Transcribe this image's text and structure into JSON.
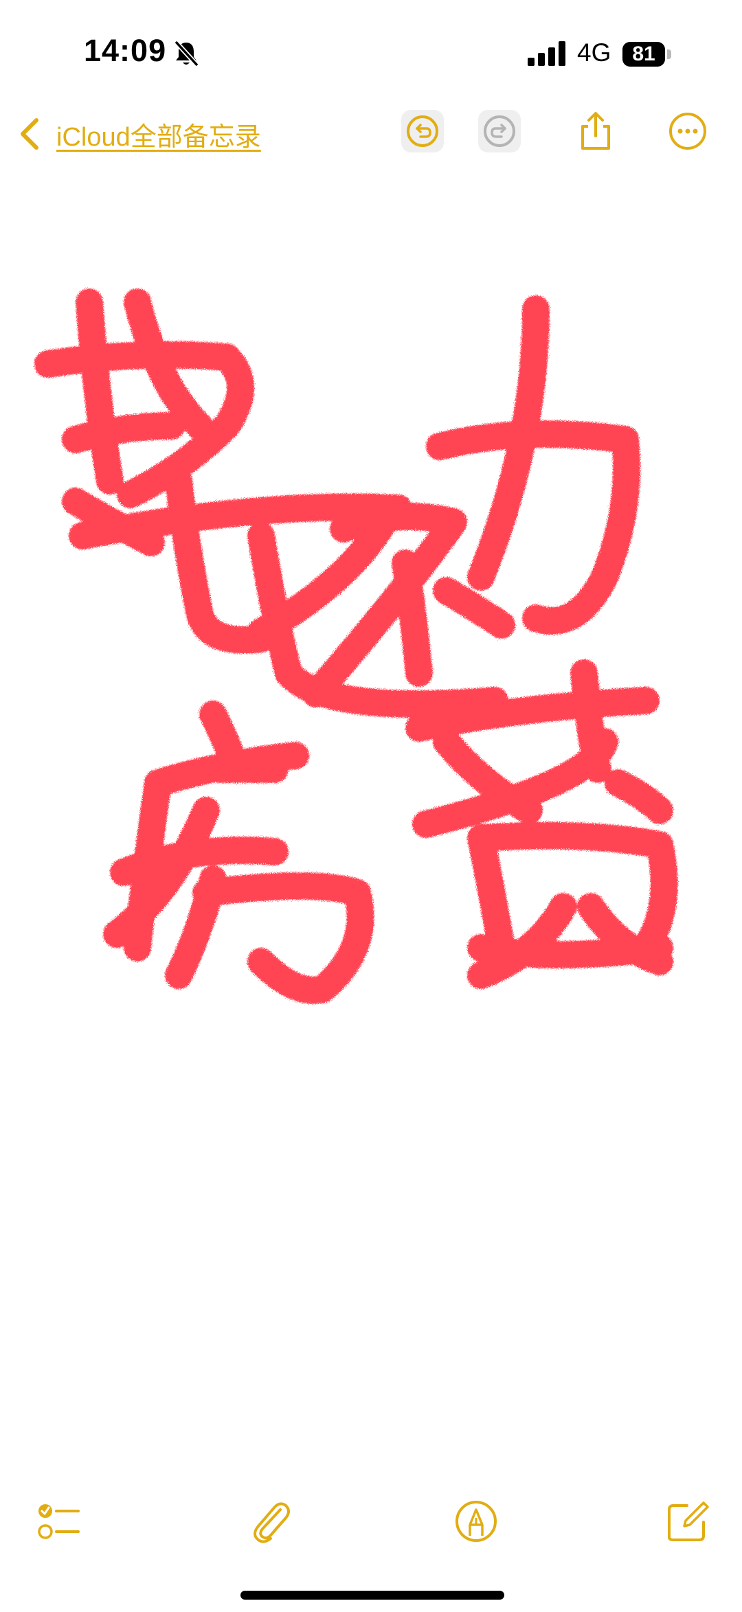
{
  "status": {
    "time": "14:09",
    "network": "4G",
    "battery": "81"
  },
  "nav": {
    "back_label": "iCloud全部备忘录"
  },
  "note": {
    "ink_color": "#ff3a4b"
  },
  "theme": {
    "accent": "#e2ad12"
  },
  "toolbar": {
    "items": [
      "checklist-icon",
      "attachment-icon",
      "markup-icon",
      "compose-icon"
    ]
  }
}
